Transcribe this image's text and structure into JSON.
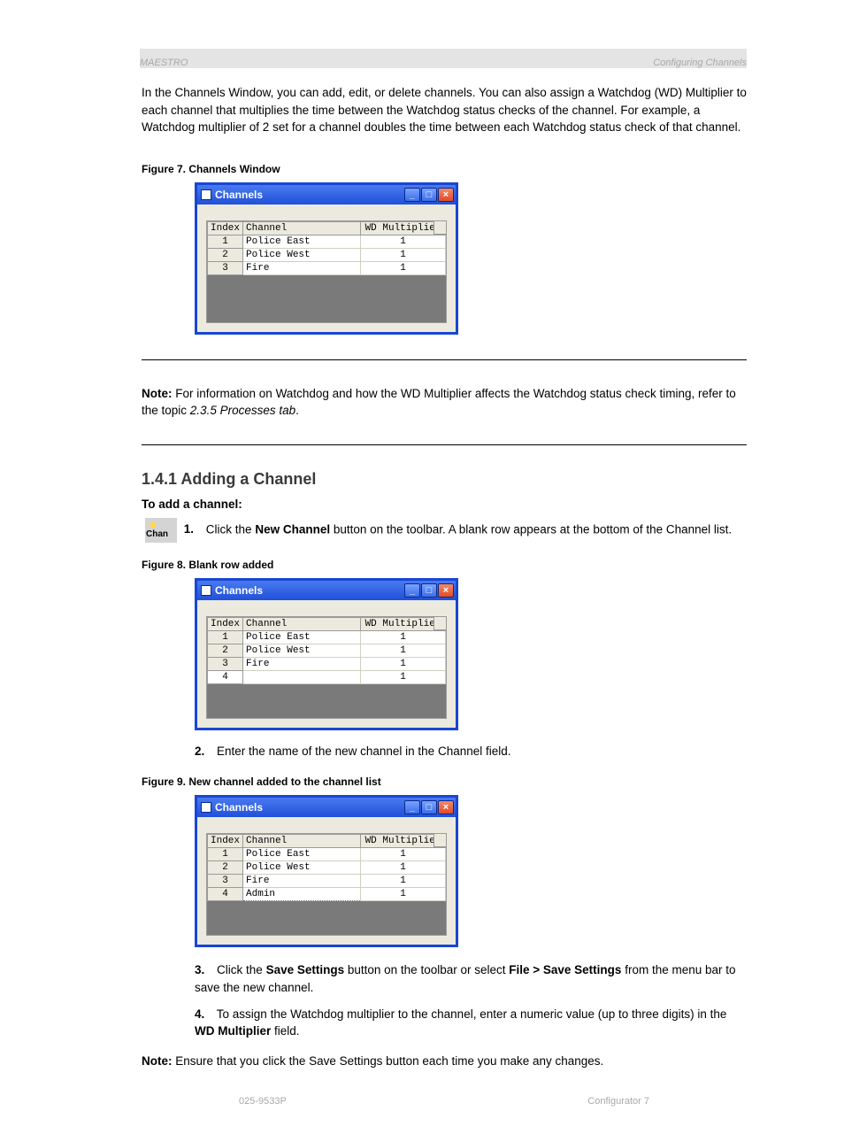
{
  "header": {
    "left": "MAESTRO",
    "right_suffix": "Configuring Channels"
  },
  "intro_para": "In the Channels Window, you can add, edit, or delete channels. You can also assign a Watchdog (WD) Multiplier to each channel that multiplies the time between the Watchdog status checks of the channel. For example, a Watchdog multiplier of 2 set for a channel doubles the time between each Watchdog status check of that channel.",
  "figures": {
    "a": {
      "caption": "Figure 7.  Channels Window"
    },
    "b": {
      "caption": "Figure 8.  Blank row added"
    },
    "c": {
      "caption": "Figure 9.  New channel added to the channel list"
    }
  },
  "win": {
    "title": "Channels",
    "columns": {
      "index": "Index",
      "channel": "Channel",
      "wd": "WD Multiplier"
    },
    "rows_a": [
      {
        "idx": "1",
        "ch": "Police East",
        "wd": "1"
      },
      {
        "idx": "2",
        "ch": "Police West",
        "wd": "1"
      },
      {
        "idx": "3",
        "ch": "Fire",
        "wd": "1"
      }
    ],
    "rows_b": [
      {
        "idx": "1",
        "ch": "Police East",
        "wd": "1"
      },
      {
        "idx": "2",
        "ch": "Police West",
        "wd": "1"
      },
      {
        "idx": "3",
        "ch": "Fire",
        "wd": "1"
      },
      {
        "idx": "4",
        "ch": "",
        "wd": "1"
      }
    ],
    "rows_c": [
      {
        "idx": "1",
        "ch": "Police East",
        "wd": "1"
      },
      {
        "idx": "2",
        "ch": "Police West",
        "wd": "1"
      },
      {
        "idx": "3",
        "ch": "Fire",
        "wd": "1"
      },
      {
        "idx": "4",
        "ch": "Admin",
        "wd": "1"
      }
    ]
  },
  "note": {
    "label": "Note:",
    "text_before": "For information on Watchdog and how the WD Multiplier affects the Watchdog status check timing, refer to the topic ",
    "topic": "2.3.5 Processes tab",
    "text_after": "."
  },
  "h2": "1.4.1 Adding a Channel",
  "task_h": "To add a channel:",
  "chan_icon_label": "Chan",
  "steps": {
    "s1_num": "1.",
    "s1_text_before": "Click the ",
    "s1_bold": "New Channel",
    "s1_text_after": " button on the toolbar. A blank row appears at the bottom of the Channel list.",
    "s2_num": "2.",
    "s2_text": "Enter the name of the new channel in the Channel field.",
    "s3_num": "3.",
    "s3_text_before": "Click the ",
    "s3_bold": "Save Settings",
    "s3_text_mid": " button on the toolbar or select ",
    "s3_menu": "File > Save Settings",
    "s3_text_after": " from the menu bar to save the new channel.",
    "s4_num": "4.",
    "s4_text_before": "To assign the Watchdog multiplier to the channel, enter a numeric value (up to three digits) in the ",
    "s4_bold": "WD Multiplier",
    "s4_text_after": " field.",
    "note2_label": "Note:",
    "note2_text": "Ensure that you click the Save Settings button each time you make any changes."
  },
  "footer": {
    "left": "025-9533P",
    "right_prefix": "Configurator  ",
    "page": "7"
  }
}
